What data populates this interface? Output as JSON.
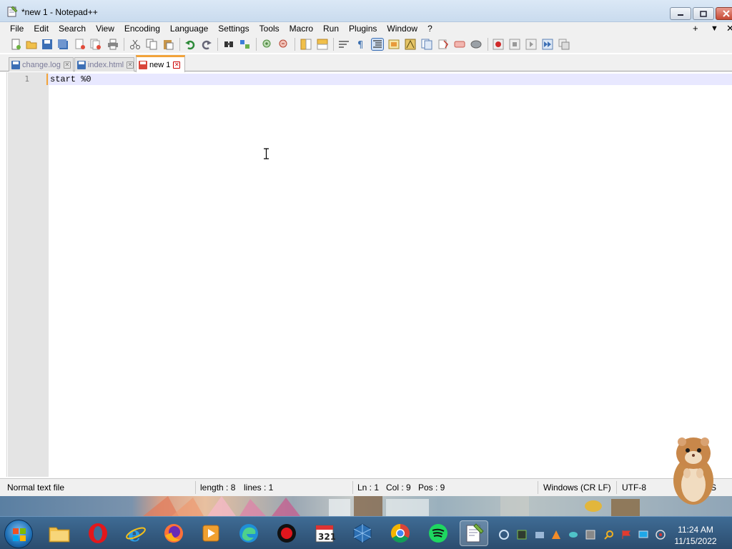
{
  "window": {
    "title": "*new 1 - Notepad++",
    "controls": {
      "minimize": "minimize",
      "maximize": "maximize",
      "close": "close"
    }
  },
  "menu": {
    "items": [
      "File",
      "Edit",
      "Search",
      "View",
      "Encoding",
      "Language",
      "Settings",
      "Tools",
      "Macro",
      "Run",
      "Plugins",
      "Window",
      "?"
    ],
    "right_controls": [
      "+",
      "▼",
      "✕"
    ]
  },
  "toolbar": {
    "buttons": [
      "new-file-icon",
      "open-file-icon",
      "save-icon",
      "save-all-icon",
      "close-icon",
      "close-all-icon",
      "print-icon",
      "cut-icon",
      "copy-icon",
      "paste-icon",
      "undo-icon",
      "redo-icon",
      "find-icon",
      "replace-icon",
      "zoom-in-icon",
      "zoom-out-icon",
      "sync-vertical-icon",
      "sync-horizontal-icon",
      "word-wrap-icon",
      "show-all-chars-icon",
      "indent-guide-icon",
      "udl-icon",
      "doc-map-icon",
      "function-list-icon",
      "folder-workspace-icon",
      "monitoring-icon",
      "record-macro-icon",
      "stop-macro-icon",
      "play-macro-icon",
      "run-macro-multiple-icon",
      "save-macro-icon"
    ]
  },
  "tabs": [
    {
      "label": "change.log",
      "active": false
    },
    {
      "label": "index.html",
      "active": false
    },
    {
      "label": "new 1",
      "active": true
    }
  ],
  "editor": {
    "lines": [
      {
        "number": "1",
        "text": "start %0"
      }
    ]
  },
  "status": {
    "file_type": "Normal text file",
    "length": "length : 8",
    "lines": "lines : 1",
    "ln": "Ln : 1",
    "col": "Col : 9",
    "pos": "Pos : 9",
    "eol": "Windows (CR LF)",
    "encoding": "UTF-8",
    "mode": "INS"
  },
  "taskbar": {
    "apps": [
      "start-orb",
      "file-explorer",
      "opera",
      "internet-explorer",
      "firefox",
      "media-player",
      "edge",
      "obs-recorder",
      "countdown-321",
      "virtualbox",
      "chrome",
      "spotify",
      "notepad-plus-plus"
    ],
    "clock": {
      "time": "11:24 AM",
      "date": "11/15/2022"
    }
  },
  "colors": {
    "tab_accent": "#f2a33a",
    "current_line": "#e8e8ff",
    "gutter": "#e4e4e4"
  }
}
